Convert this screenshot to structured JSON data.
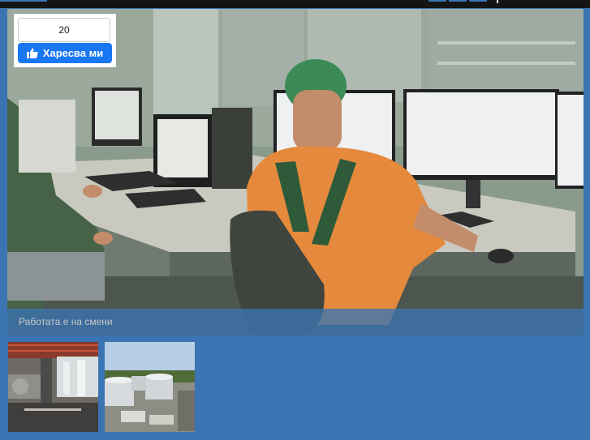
{
  "like_widget": {
    "count": "20",
    "button_label": "Харесва ми",
    "icon": "thumbs-up-icon",
    "button_color": "#1877f2"
  },
  "gallery": {
    "main_image": "control-room-photo",
    "caption": "Работата е на смени",
    "caption_bar_color": "#3a74b2",
    "thumbnails": [
      {
        "icon": "industrial-hall-photo"
      },
      {
        "icon": "storage-tanks-photo"
      }
    ]
  },
  "colors": {
    "page_background": "#3a74b2",
    "top_bar": "#141414"
  }
}
